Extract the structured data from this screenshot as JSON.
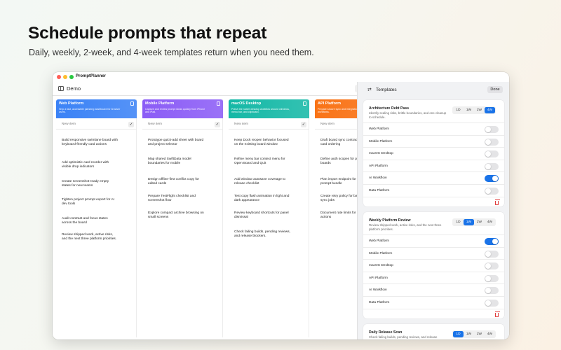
{
  "hero": {
    "title": "Schedule prompts that repeat",
    "subtitle": "Daily, weekly, 2-week, and 4-week templates return when you need them."
  },
  "app": {
    "title": "PromptPlanner",
    "board_title": "Demo",
    "add_symbol": "+"
  },
  "new_item_placeholder": "New item",
  "check_symbol": "✓",
  "columns": [
    {
      "name": "Web Platform",
      "color": "#3b82f6",
      "description": "Ship a fast, accessible planning dashboard for browser users.",
      "cards": [
        "Build responsive swimlane board with keyboard-friendly card actions",
        "Add optimistic card reorder with visible drop indicators",
        "Create screenshot-ready empty states for new teams",
        "Tighten project prompt export for AI dev tools",
        "Audit contrast and focus states across the board",
        "Review shipped work, active risks, and the next three platform priorities."
      ]
    },
    {
      "name": "Mobile Platform",
      "color": "#8b5cf6",
      "description": "Capture and review prompt ideas quickly from iPhone and iPad.",
      "cards": [
        "Prototype quick-add sheet with board and project selector",
        "Map shared SwiftData model boundaries for mobile",
        "Design offline-first conflict copy for edited cards",
        "Prepare TestFlight checklist and screenshot flow",
        "Explore compact archive browsing on small screens"
      ]
    },
    {
      "name": "macOS Desktop",
      "color": "#14b8a6",
      "description": "Polish the native desktop workflow around windows, menu bar, and clipboard.",
      "cards": [
        "Keep Dock reopen behavior focused on the existing board window",
        "Refine menu bar context menu for Open Board and Quit",
        "Add window autosave coverage to release checklist",
        "Test copy flash animation in light and dark appearance",
        "Review keyboard shortcuts for panel dismissal",
        "Check failing builds, pending reviews, and release blockers."
      ]
    },
    {
      "name": "API Platform",
      "color": "#f97316",
      "description": "Prepare secure sync and integration points for team workflows.",
      "cards": [
        "Draft board sync contract project and card ordering",
        "Define auth scopes for pe and team boards",
        "Plan import endpoint for markdown prompt bundle",
        "Create retry policy for background sync jobs",
        "Document rate limits for recurrence actions"
      ]
    }
  ],
  "panel": {
    "icon": "⇄",
    "title": "Templates",
    "done_label": "Done",
    "accent": "#1a73e8",
    "frequency_options": [
      "1D",
      "1W",
      "2W",
      "4W"
    ],
    "templates": [
      {
        "name": "Architecture Debt Pass",
        "description": "Identify scaling risks, brittle boundaries, and one cleanup to schedule.",
        "frequency": "4W",
        "columns": [
          {
            "label": "Web Platform",
            "enabled": false
          },
          {
            "label": "Mobile Platform",
            "enabled": false
          },
          {
            "label": "macOS Desktop",
            "enabled": false
          },
          {
            "label": "API Platform",
            "enabled": false
          },
          {
            "label": "AI Workflow",
            "enabled": true
          },
          {
            "label": "Data Platform",
            "enabled": false
          }
        ]
      },
      {
        "name": "Weekly Platform Review",
        "description": "Review shipped work, active risks, and the next three platform priorities.",
        "frequency": "1W",
        "columns": [
          {
            "label": "Web Platform",
            "enabled": true
          },
          {
            "label": "Mobile Platform",
            "enabled": false
          },
          {
            "label": "macOS Desktop",
            "enabled": false
          },
          {
            "label": "API Platform",
            "enabled": false
          },
          {
            "label": "AI Workflow",
            "enabled": false
          },
          {
            "label": "Data Platform",
            "enabled": false
          }
        ]
      },
      {
        "name": "Daily Release Scan",
        "description": "Check failing builds, pending reviews, and release blockers.",
        "frequency": "1D",
        "columns": []
      }
    ]
  }
}
